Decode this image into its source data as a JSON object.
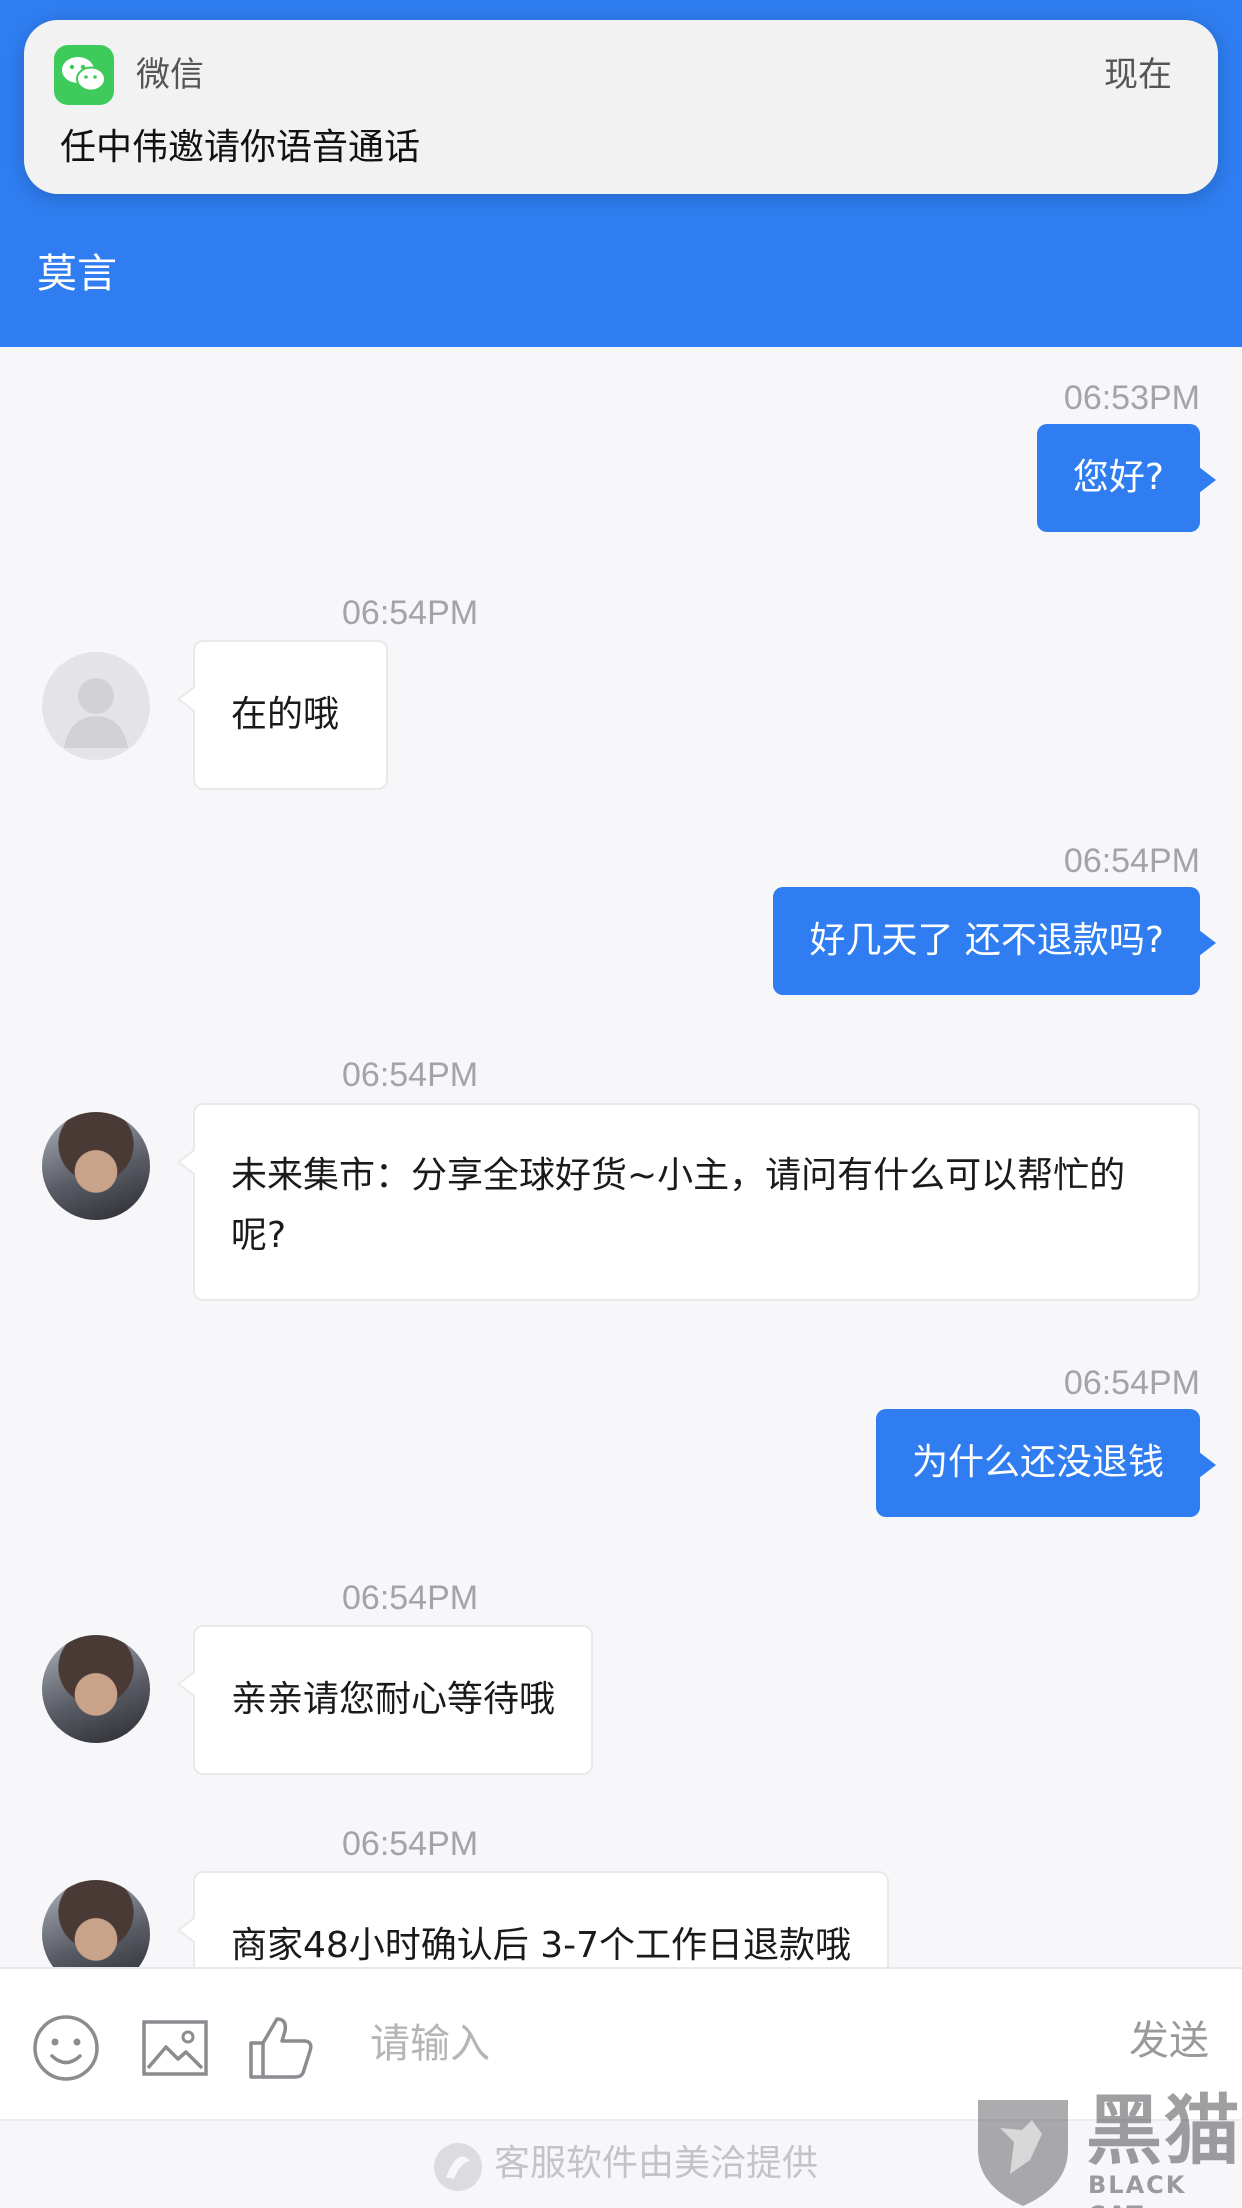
{
  "notification": {
    "app_name": "微信",
    "time": "现在",
    "message": "任中伟邀请你语音通话"
  },
  "header": {
    "title": "莫言"
  },
  "messages": [
    {
      "side": "out",
      "time": "06:53PM",
      "text": "您好?"
    },
    {
      "side": "in",
      "time": "06:54PM",
      "avatar": "default",
      "text": "在的哦"
    },
    {
      "side": "out",
      "time": "06:54PM",
      "text": "好几天了 还不退款吗?"
    },
    {
      "side": "in",
      "time": "06:54PM",
      "avatar": "photo",
      "text": "未来集市：分享全球好货~小主，请问有什么可以帮忙的呢?"
    },
    {
      "side": "out",
      "time": "06:54PM",
      "text": "为什么还没退钱"
    },
    {
      "side": "in",
      "time": "06:54PM",
      "avatar": "photo",
      "text": "亲亲请您耐心等待哦"
    },
    {
      "side": "in",
      "time": "06:54PM",
      "avatar": "photo",
      "text": "商家48小时确认后 3-7个工作日退款哦"
    }
  ],
  "input": {
    "placeholder": "请输入",
    "send_label": "发送"
  },
  "footer": {
    "text": "客服软件由美洽提供"
  },
  "watermark": {
    "cn": "黑猫",
    "en": "BLACK CAT"
  },
  "colors": {
    "accent": "#2f7df0",
    "wechat_green": "#3fca5c",
    "background": "#f7f7f9"
  }
}
